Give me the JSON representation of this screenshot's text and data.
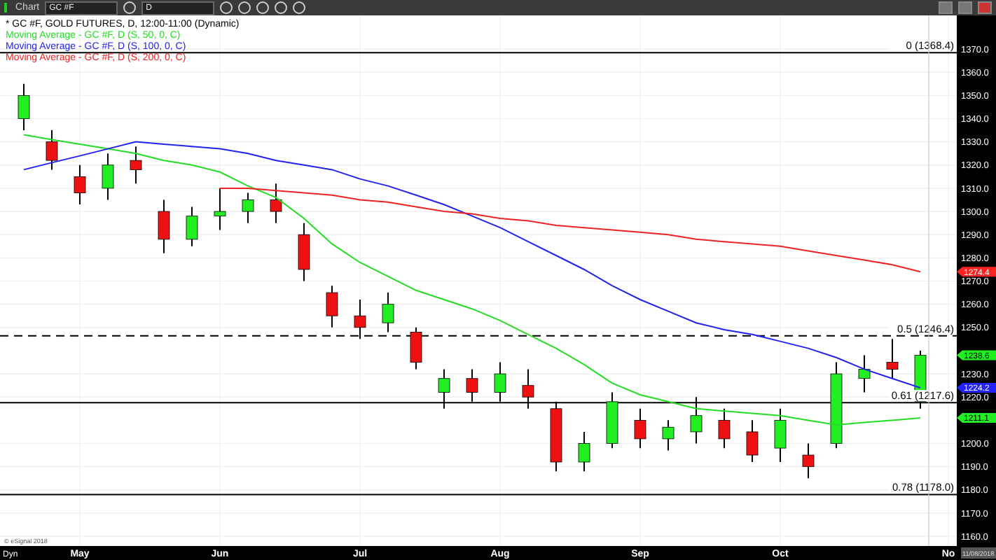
{
  "toolbar": {
    "title": "Chart",
    "symbol": "GC #F",
    "interval": "D"
  },
  "chart_data": {
    "type": "candlestick",
    "title": "* GC #F, GOLD FUTURES, D, 12:00-11:00 (Dynamic)",
    "grid": true,
    "ylim": [
      1155.8,
      1384.5
    ],
    "categories": [
      null,
      null,
      "May",
      null,
      null,
      null,
      null,
      "Jun",
      null,
      null,
      null,
      null,
      "Jul",
      null,
      null,
      null,
      null,
      "Aug",
      null,
      null,
      null,
      null,
      "Sep",
      null,
      null,
      null,
      null,
      "Oct",
      null,
      null,
      null,
      null,
      null,
      "No"
    ],
    "yticks": [
      {
        "value": 1160,
        "label": "1160.0"
      },
      {
        "value": 1170,
        "label": "1170.0"
      },
      {
        "value": 1180,
        "label": "1180.0"
      },
      {
        "value": 1190,
        "label": "1190.0"
      },
      {
        "value": 1200,
        "label": "1200.0"
      },
      {
        "value": 1220,
        "label": "1220.0"
      },
      {
        "value": 1230,
        "label": "1230.0"
      },
      {
        "value": 1250,
        "label": "1250.0"
      },
      {
        "value": 1260,
        "label": "1260.0"
      },
      {
        "value": 1270,
        "label": "1270.0"
      },
      {
        "value": 1280,
        "label": "1280.0"
      },
      {
        "value": 1290,
        "label": "1290.0"
      },
      {
        "value": 1300,
        "label": "1300.0"
      },
      {
        "value": 1310,
        "label": "1310.0"
      },
      {
        "value": 1320,
        "label": "1320.0"
      },
      {
        "value": 1330,
        "label": "1330.0"
      },
      {
        "value": 1340,
        "label": "1340.0"
      },
      {
        "value": 1350,
        "label": "1350.0"
      },
      {
        "value": 1360,
        "label": "1360.0"
      },
      {
        "value": 1370,
        "label": "1370.0"
      }
    ],
    "ohlc": [
      [
        1340,
        1355,
        1335,
        1350
      ],
      [
        1330,
        1335,
        1318,
        1322
      ],
      [
        1315,
        1320,
        1303,
        1308
      ],
      [
        1310,
        1325,
        1305,
        1320
      ],
      [
        1322,
        1328,
        1312,
        1318
      ],
      [
        1300,
        1305,
        1282,
        1288
      ],
      [
        1288,
        1302,
        1285,
        1298
      ],
      [
        1298,
        1310,
        1292,
        1300
      ],
      [
        1300,
        1308,
        1295,
        1305
      ],
      [
        1305,
        1312,
        1295,
        1300
      ],
      [
        1290,
        1295,
        1270,
        1275
      ],
      [
        1265,
        1268,
        1250,
        1255
      ],
      [
        1255,
        1262,
        1245,
        1250
      ],
      [
        1252,
        1265,
        1248,
        1260
      ],
      [
        1248,
        1250,
        1232,
        1235
      ],
      [
        1222,
        1232,
        1215,
        1228
      ],
      [
        1228,
        1232,
        1218,
        1222
      ],
      [
        1222,
        1235,
        1218,
        1230
      ],
      [
        1225,
        1232,
        1215,
        1220
      ],
      [
        1215,
        1218,
        1188,
        1192
      ],
      [
        1192,
        1205,
        1188,
        1200
      ],
      [
        1200,
        1222,
        1198,
        1218
      ],
      [
        1210,
        1215,
        1198,
        1202
      ],
      [
        1202,
        1210,
        1197,
        1207
      ],
      [
        1205,
        1220,
        1200,
        1212
      ],
      [
        1210,
        1215,
        1198,
        1202
      ],
      [
        1205,
        1210,
        1192,
        1195
      ],
      [
        1198,
        1215,
        1192,
        1210
      ],
      [
        1195,
        1200,
        1185,
        1190
      ],
      [
        1200,
        1235,
        1198,
        1230
      ],
      [
        1228,
        1238,
        1222,
        1232
      ],
      [
        1235,
        1245,
        1228,
        1232
      ],
      [
        1218,
        1240,
        1215,
        1238
      ],
      null
    ],
    "series": [
      {
        "name": "Moving Average - GC #F, D (S, 50, 0, C)",
        "type": "line",
        "color": "#22dd22",
        "values": [
          1333,
          1331,
          1329,
          1327,
          1325,
          1322,
          1320,
          1317,
          1311,
          1306,
          1297,
          1286,
          1278,
          1272,
          1266,
          1262,
          1258,
          1253,
          1247,
          1241,
          1234,
          1226,
          1221,
          1218,
          1215,
          1214,
          1213,
          1212,
          1210,
          1208,
          1209,
          1210,
          1211,
          null
        ]
      },
      {
        "name": "Moving Average - GC #F, D (S, 100, 0, C)",
        "type": "line",
        "color": "#2222ee",
        "values": [
          1318,
          1321,
          1324,
          1327,
          1330,
          1329,
          1328,
          1327,
          1325,
          1322,
          1320,
          1318,
          1314,
          1311,
          1307,
          1303,
          1298,
          1293,
          1287,
          1281,
          1275,
          1268,
          1262,
          1257,
          1252,
          1249,
          1247,
          1244,
          1241,
          1237,
          1232,
          1228,
          1224,
          null
        ]
      },
      {
        "name": "Moving Average - GC #F, D (S, 200, 0, C)",
        "type": "line",
        "color": "#ee2222",
        "values": [
          null,
          null,
          null,
          null,
          null,
          null,
          null,
          1310,
          1310,
          1309,
          1308,
          1307,
          1305,
          1304,
          1302,
          1300,
          1299,
          1297,
          1296,
          1294,
          1293,
          1292,
          1291,
          1290,
          1288,
          1287,
          1286,
          1285,
          1283,
          1281,
          1279,
          1277,
          1274,
          null
        ]
      }
    ],
    "ref_lines": [
      {
        "axis": "y",
        "value": 1368.4,
        "label": "0 (1368.4)"
      },
      {
        "axis": "y",
        "value": 1246.4,
        "label": "0.5 (1246.4)"
      },
      {
        "axis": "y",
        "value": 1217.6,
        "label": "0.61 (1217.6)"
      },
      {
        "axis": "y",
        "value": 1178.0,
        "label": "0.78 (1178.0)"
      }
    ]
  },
  "price_tags": [
    {
      "text": "1274.4",
      "color": "#ff2222"
    },
    {
      "text": "1238.6",
      "color": "#22ee22"
    },
    {
      "text": "1224.2",
      "color": "#2222ff"
    },
    {
      "text": "1211.1",
      "color": "#22ee22"
    }
  ],
  "bottom_bar": {
    "mode": "Dyn",
    "date": "11/08/2018"
  },
  "copyright": "© eSignal 2018"
}
